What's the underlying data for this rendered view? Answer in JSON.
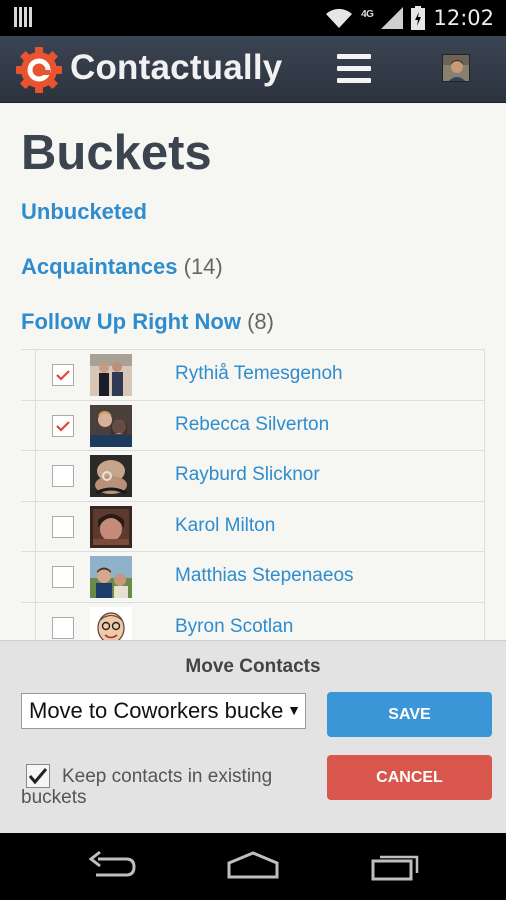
{
  "status_bar": {
    "network": "4G",
    "time": "12:02"
  },
  "header": {
    "brand": "Contactually"
  },
  "page": {
    "title": "Buckets"
  },
  "buckets": [
    {
      "name": "Unbucketed",
      "count": ""
    },
    {
      "name": "Acquaintances",
      "count": "(14)"
    },
    {
      "name": "Follow Up Right Now",
      "count": "(8)"
    }
  ],
  "contacts": [
    {
      "name": "Rythiå  Temesgenoh",
      "checked": true
    },
    {
      "name": "Rebecca Silverton",
      "checked": true
    },
    {
      "name": "Rayburd Slicknor",
      "checked": false
    },
    {
      "name": "Karol Milton",
      "checked": false
    },
    {
      "name": "Matthias Stepenaeos",
      "checked": false
    },
    {
      "name": "Byron Scotlan",
      "checked": false
    }
  ],
  "move_panel": {
    "title": "Move Contacts",
    "select_value": "Move to Coworkers bucket",
    "save_label": "SAVE",
    "cancel_label": "CANCEL",
    "keep_label": "Keep contacts in existing buckets",
    "keep_checked": true
  },
  "colors": {
    "link": "#2f8ccd",
    "save": "#3a96d6",
    "cancel": "#d9564c",
    "check": "#e0453a"
  }
}
